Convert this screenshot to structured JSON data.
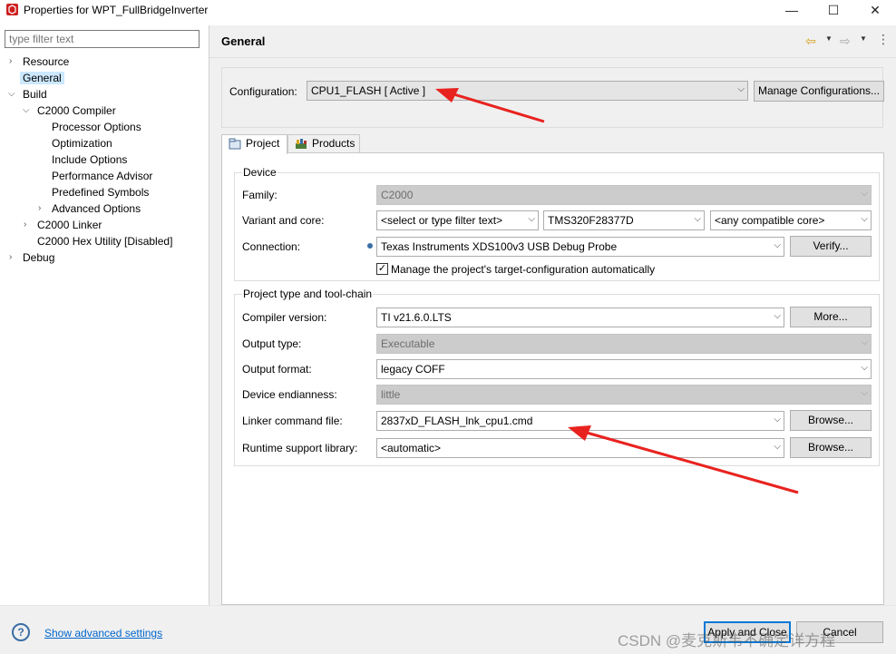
{
  "window": {
    "title": "Properties for WPT_FullBridgeInverter",
    "minimize": "—",
    "maximize": "☐",
    "close": "✕"
  },
  "sidebar": {
    "filter_placeholder": "type filter text",
    "items": [
      {
        "label": "Resource"
      },
      {
        "label": "General"
      },
      {
        "label": "Build"
      },
      {
        "label": "C2000 Compiler"
      },
      {
        "label": "Processor Options"
      },
      {
        "label": "Optimization"
      },
      {
        "label": "Include Options"
      },
      {
        "label": "Performance Advisor"
      },
      {
        "label": "Predefined Symbols"
      },
      {
        "label": "Advanced Options"
      },
      {
        "label": "C2000 Linker"
      },
      {
        "label": "C2000 Hex Utility  [Disabled]"
      },
      {
        "label": "Debug"
      }
    ]
  },
  "header": {
    "title": "General"
  },
  "configuration": {
    "label": "Configuration:",
    "value": "CPU1_FLASH  [ Active ]",
    "manage_button": "Manage Configurations..."
  },
  "tabs": [
    {
      "label": "Project"
    },
    {
      "label": "Products"
    }
  ],
  "device": {
    "group_title": "Device",
    "family_label": "Family:",
    "family_value": "C2000",
    "variant_label": "Variant and core:",
    "variant_filter": "<select or type filter text>",
    "variant_value": "TMS320F28377D",
    "core_value": "<any compatible core>",
    "connection_label": "Connection:",
    "connection_value": "Texas Instruments XDS100v3 USB Debug Probe",
    "verify_button": "Verify...",
    "manage_checkbox_label": "Manage the project's target-configuration automatically",
    "manage_checked": true
  },
  "toolchain": {
    "group_title": "Project type and tool-chain",
    "compiler_label": "Compiler version:",
    "compiler_value": "TI v21.6.0.LTS",
    "more_button": "More...",
    "output_type_label": "Output type:",
    "output_type_value": "Executable",
    "output_format_label": "Output format:",
    "output_format_value": "legacy COFF",
    "endianness_label": "Device endianness:",
    "endianness_value": "little",
    "linker_label": "Linker command file:",
    "linker_value": "2837xD_FLASH_lnk_cpu1.cmd",
    "browse_button": "Browse...",
    "runtime_label": "Runtime support library:",
    "runtime_value": "<automatic>"
  },
  "footer": {
    "help": "?",
    "advanced_link": "Show advanced settings",
    "apply_button": "Apply and Close",
    "cancel_button": "Cancel",
    "watermark": "CSDN @麦克斯韦不确定详方程"
  },
  "colors": {
    "selection": "#cce8ff",
    "link": "#0066cc",
    "annotation_arrow": "#e8231f",
    "focus_border": "#0078d7"
  }
}
